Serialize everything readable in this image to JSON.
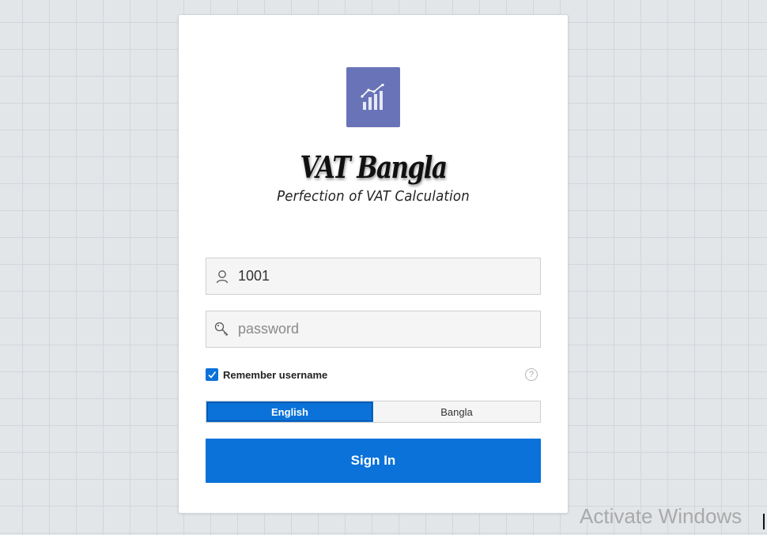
{
  "brand": {
    "name": "VAT Bangla",
    "tagline": "Perfection of VAT Calculation",
    "logo_icon": "chart-growth-icon",
    "logo_color": "#6974b8"
  },
  "login": {
    "username_value": "1001",
    "username_icon": "user-icon",
    "password_placeholder": "password",
    "password_icon": "key-icon",
    "remember_label": "Remember username",
    "remember_checked": true,
    "help_symbol": "?",
    "languages": [
      "English",
      "Bangla"
    ],
    "selected_language": "English",
    "sign_in_label": "Sign In"
  },
  "watermark": {
    "text": "Activate Windows"
  },
  "colors": {
    "accent": "#0a72d9",
    "background": "#e3e6e9"
  }
}
